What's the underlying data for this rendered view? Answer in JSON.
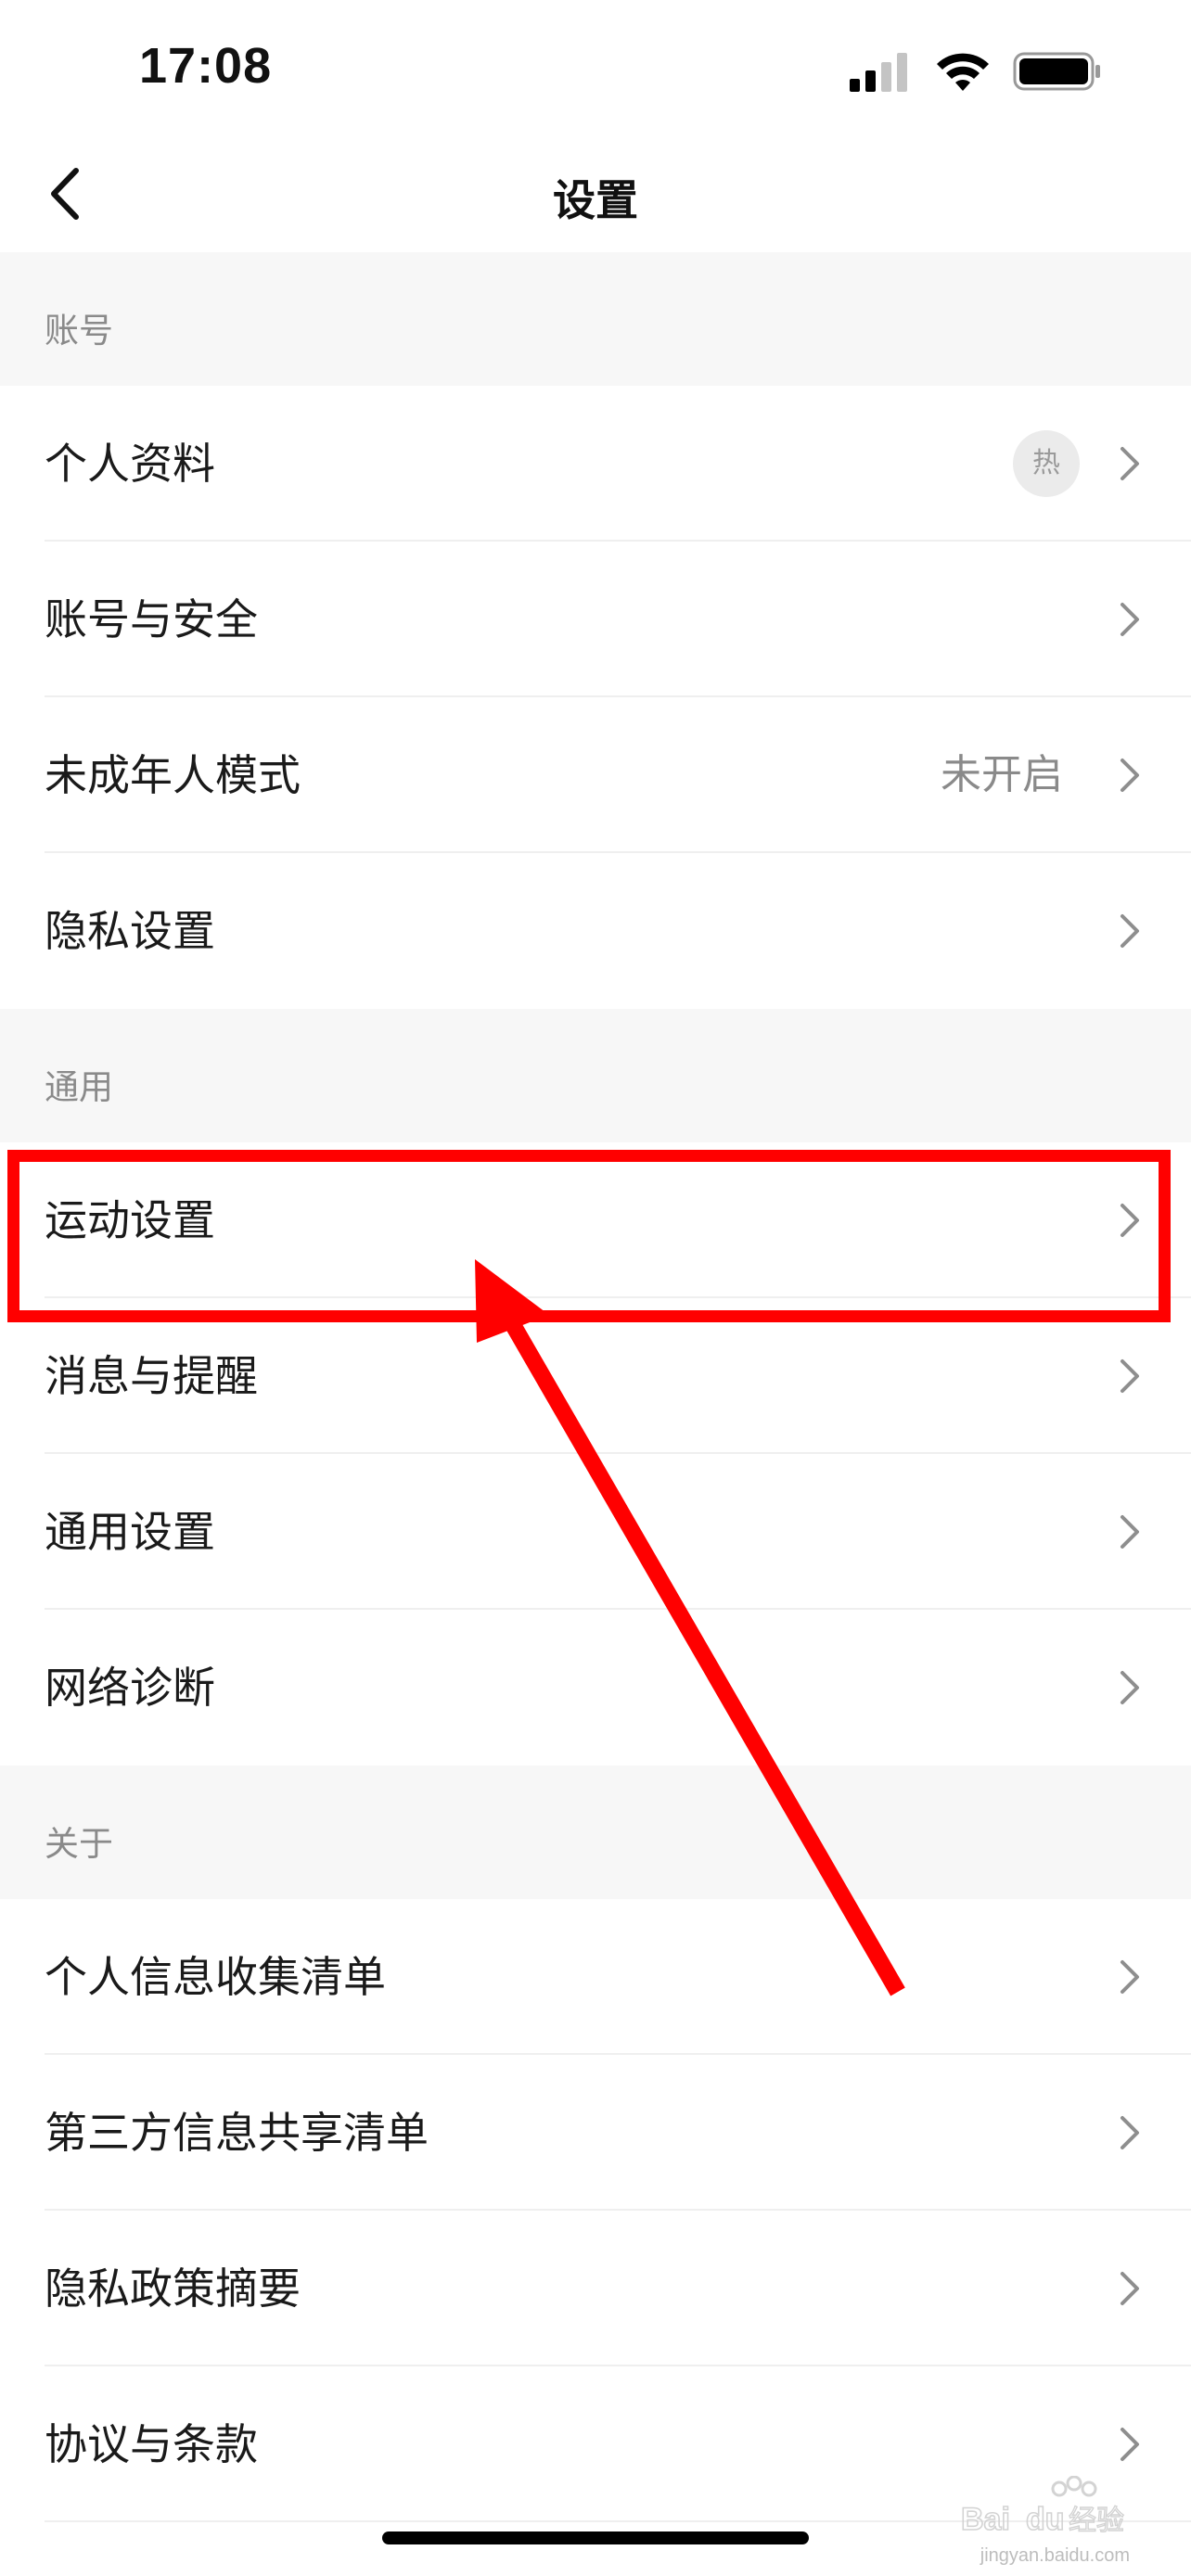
{
  "status": {
    "time": "17:08"
  },
  "nav": {
    "title": "设置"
  },
  "sections": [
    {
      "header": "账号",
      "items": [
        {
          "label": "个人资料",
          "badge": "热"
        },
        {
          "label": "账号与安全"
        },
        {
          "label": "未成年人模式",
          "value": "未开启"
        },
        {
          "label": "隐私设置"
        }
      ]
    },
    {
      "header": "通用",
      "items": [
        {
          "label": "运动设置",
          "highlighted": true
        },
        {
          "label": "消息与提醒"
        },
        {
          "label": "通用设置"
        },
        {
          "label": "网络诊断"
        }
      ]
    },
    {
      "header": "关于",
      "items": [
        {
          "label": "个人信息收集清单"
        },
        {
          "label": "第三方信息共享清单"
        },
        {
          "label": "隐私政策摘要"
        },
        {
          "label": "协议与条款"
        }
      ]
    }
  ],
  "annotation": {
    "color": "#ff0000",
    "arrow_icon": "arrow-pointer-icon"
  },
  "watermark": {
    "logo_text": "Bai du 经验",
    "url": "jingyan.baidu.com"
  }
}
